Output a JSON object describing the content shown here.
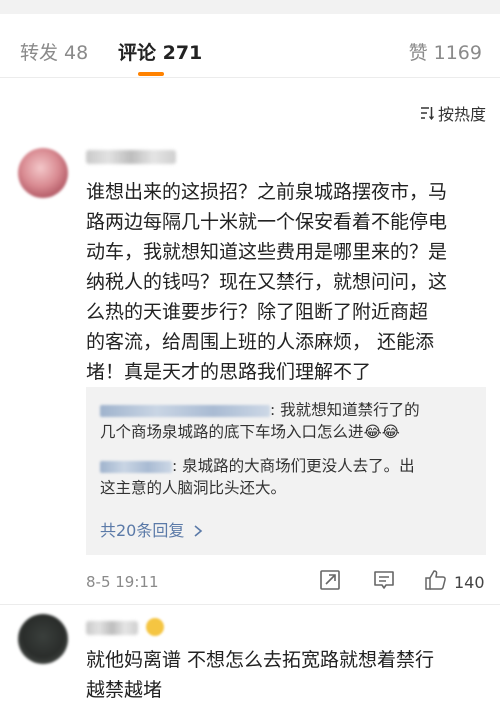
{
  "tabs": {
    "repost": "转发 48",
    "comments": "评论 271",
    "likes": "赞 1169"
  },
  "sort_label": "按热度",
  "comment1": {
    "lines": [
      "谁想出来的这损招？之前泉城路摆夜市，马",
      "路两边每隔几十米就一个保安看着不能停电",
      "动车，我就想知道这些费用是哪里来的？是",
      "纳税人的钱吗？现在又禁行，就想问问，这",
      "么热的天谁要步行？除了阻断了附近商超",
      "的客流，给周围上班的人添麻烦，  还能添",
      "堵！真是天才的思路我们理解不了"
    ],
    "replies": [
      {
        "line1": ": 我就想知道禁行了的",
        "line2": "几个商场泉城路的底下车场入口怎么进😂😂"
      },
      {
        "line1": ": 泉城路的大商场们更没人去了。出",
        "line2": "这主意的人脑洞比头还大。"
      }
    ],
    "more_replies": "共20条回复",
    "time": "8-5 19:11",
    "like_count": "140"
  },
  "comment2": {
    "lines": [
      "就他妈离谱 不想怎么去拓宽路就想着禁行",
      "越禁越堵"
    ]
  },
  "icons": {
    "sort": "sort-icon",
    "repost": "repost-icon",
    "comment": "comment-icon",
    "like": "thumbs-up-icon",
    "chevron": "chevron-right-icon"
  },
  "colors": {
    "accent": "#ff8200",
    "link": "#5b7aa8",
    "reply_bg": "#f2f2f2"
  }
}
